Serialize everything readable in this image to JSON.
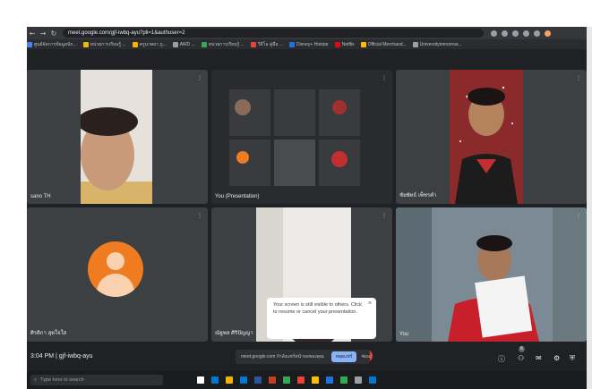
{
  "browser": {
    "url": "meet.google.com/gjf-iwbq-ayu?pli=1&authuser=2",
    "bookmarks": [
      {
        "label": "ศูนย์จัดการข้อมูลนัก...",
        "color": "#4285f4"
      },
      {
        "label": "หน่วยการเรียนรู้ ...",
        "color": "#f4b400"
      },
      {
        "label": "ครูนาตยา ภู...",
        "color": "#f4b400"
      },
      {
        "label": "AWD ...",
        "color": "#9aa0a6"
      },
      {
        "label": "หน่วยการเรียนรู้ ...",
        "color": "#34a853"
      },
      {
        "label": "วีดีโอ คู่มือ ...",
        "color": "#ea4335"
      },
      {
        "label": "Disney+ Hotstar",
        "color": "#1a73e8"
      },
      {
        "label": "Netflix",
        "color": "#e50914"
      },
      {
        "label": "Official Merchand...",
        "color": "#fbbc04"
      },
      {
        "label": "Universitytomorrow...",
        "color": "#9aa0a6"
      }
    ]
  },
  "tiles": {
    "t1": {
      "name": "sano TH"
    },
    "t2": {
      "name": "You (Presentation)"
    },
    "t3": {
      "name": "ชัยพัทธ์ เพ็ชรคำ"
    },
    "t4": {
      "name": "ศิรดิกา สุดใจใส"
    },
    "t5": {
      "name": "ณัฐพล ศิริปัญญา"
    },
    "t6": {
      "name": "You"
    }
  },
  "toast": {
    "text": "Your screen is still visible to others. Click to resume or cancel your presentation.",
    "close": "×"
  },
  "toolbar": {
    "time": "3:04 PM",
    "meeting_code": "gjf-iwbq-ayu",
    "share_text": "meet.google.com กำลังแชร์หน้าจอของคุณ",
    "stop_label": "หยุดแชร์",
    "hide_label": "ซ่อน",
    "participant_count": "6"
  },
  "taskbar": {
    "search_placeholder": "Type here to search"
  }
}
